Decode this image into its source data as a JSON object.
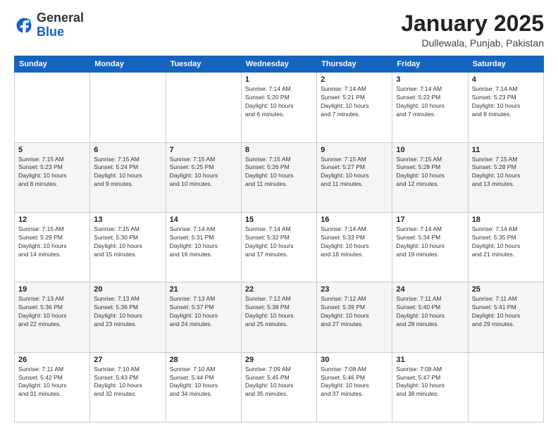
{
  "header": {
    "logo_general": "General",
    "logo_blue": "Blue",
    "month_title": "January 2025",
    "location": "Dullewala, Punjab, Pakistan"
  },
  "weekdays": [
    "Sunday",
    "Monday",
    "Tuesday",
    "Wednesday",
    "Thursday",
    "Friday",
    "Saturday"
  ],
  "weeks": [
    [
      {
        "day": "",
        "info": ""
      },
      {
        "day": "",
        "info": ""
      },
      {
        "day": "",
        "info": ""
      },
      {
        "day": "1",
        "info": "Sunrise: 7:14 AM\nSunset: 5:20 PM\nDaylight: 10 hours\nand 6 minutes."
      },
      {
        "day": "2",
        "info": "Sunrise: 7:14 AM\nSunset: 5:21 PM\nDaylight: 10 hours\nand 7 minutes."
      },
      {
        "day": "3",
        "info": "Sunrise: 7:14 AM\nSunset: 5:22 PM\nDaylight: 10 hours\nand 7 minutes."
      },
      {
        "day": "4",
        "info": "Sunrise: 7:14 AM\nSunset: 5:23 PM\nDaylight: 10 hours\nand 8 minutes."
      }
    ],
    [
      {
        "day": "5",
        "info": "Sunrise: 7:15 AM\nSunset: 5:23 PM\nDaylight: 10 hours\nand 8 minutes."
      },
      {
        "day": "6",
        "info": "Sunrise: 7:15 AM\nSunset: 5:24 PM\nDaylight: 10 hours\nand 9 minutes."
      },
      {
        "day": "7",
        "info": "Sunrise: 7:15 AM\nSunset: 5:25 PM\nDaylight: 10 hours\nand 10 minutes."
      },
      {
        "day": "8",
        "info": "Sunrise: 7:15 AM\nSunset: 5:26 PM\nDaylight: 10 hours\nand 11 minutes."
      },
      {
        "day": "9",
        "info": "Sunrise: 7:15 AM\nSunset: 5:27 PM\nDaylight: 10 hours\nand 11 minutes."
      },
      {
        "day": "10",
        "info": "Sunrise: 7:15 AM\nSunset: 5:28 PM\nDaylight: 10 hours\nand 12 minutes."
      },
      {
        "day": "11",
        "info": "Sunrise: 7:15 AM\nSunset: 5:28 PM\nDaylight: 10 hours\nand 13 minutes."
      }
    ],
    [
      {
        "day": "12",
        "info": "Sunrise: 7:15 AM\nSunset: 5:29 PM\nDaylight: 10 hours\nand 14 minutes."
      },
      {
        "day": "13",
        "info": "Sunrise: 7:15 AM\nSunset: 5:30 PM\nDaylight: 10 hours\nand 15 minutes."
      },
      {
        "day": "14",
        "info": "Sunrise: 7:14 AM\nSunset: 5:31 PM\nDaylight: 10 hours\nand 16 minutes."
      },
      {
        "day": "15",
        "info": "Sunrise: 7:14 AM\nSunset: 5:32 PM\nDaylight: 10 hours\nand 17 minutes."
      },
      {
        "day": "16",
        "info": "Sunrise: 7:14 AM\nSunset: 5:33 PM\nDaylight: 10 hours\nand 18 minutes."
      },
      {
        "day": "17",
        "info": "Sunrise: 7:14 AM\nSunset: 5:34 PM\nDaylight: 10 hours\nand 19 minutes."
      },
      {
        "day": "18",
        "info": "Sunrise: 7:14 AM\nSunset: 5:35 PM\nDaylight: 10 hours\nand 21 minutes."
      }
    ],
    [
      {
        "day": "19",
        "info": "Sunrise: 7:13 AM\nSunset: 5:36 PM\nDaylight: 10 hours\nand 22 minutes."
      },
      {
        "day": "20",
        "info": "Sunrise: 7:13 AM\nSunset: 5:36 PM\nDaylight: 10 hours\nand 23 minutes."
      },
      {
        "day": "21",
        "info": "Sunrise: 7:13 AM\nSunset: 5:37 PM\nDaylight: 10 hours\nand 24 minutes."
      },
      {
        "day": "22",
        "info": "Sunrise: 7:12 AM\nSunset: 5:38 PM\nDaylight: 10 hours\nand 25 minutes."
      },
      {
        "day": "23",
        "info": "Sunrise: 7:12 AM\nSunset: 5:39 PM\nDaylight: 10 hours\nand 27 minutes."
      },
      {
        "day": "24",
        "info": "Sunrise: 7:11 AM\nSunset: 5:40 PM\nDaylight: 10 hours\nand 28 minutes."
      },
      {
        "day": "25",
        "info": "Sunrise: 7:11 AM\nSunset: 5:41 PM\nDaylight: 10 hours\nand 29 minutes."
      }
    ],
    [
      {
        "day": "26",
        "info": "Sunrise: 7:11 AM\nSunset: 5:42 PM\nDaylight: 10 hours\nand 31 minutes."
      },
      {
        "day": "27",
        "info": "Sunrise: 7:10 AM\nSunset: 5:43 PM\nDaylight: 10 hours\nand 32 minutes."
      },
      {
        "day": "28",
        "info": "Sunrise: 7:10 AM\nSunset: 5:44 PM\nDaylight: 10 hours\nand 34 minutes."
      },
      {
        "day": "29",
        "info": "Sunrise: 7:09 AM\nSunset: 5:45 PM\nDaylight: 10 hours\nand 35 minutes."
      },
      {
        "day": "30",
        "info": "Sunrise: 7:08 AM\nSunset: 5:46 PM\nDaylight: 10 hours\nand 37 minutes."
      },
      {
        "day": "31",
        "info": "Sunrise: 7:08 AM\nSunset: 5:47 PM\nDaylight: 10 hours\nand 38 minutes."
      },
      {
        "day": "",
        "info": ""
      }
    ]
  ]
}
